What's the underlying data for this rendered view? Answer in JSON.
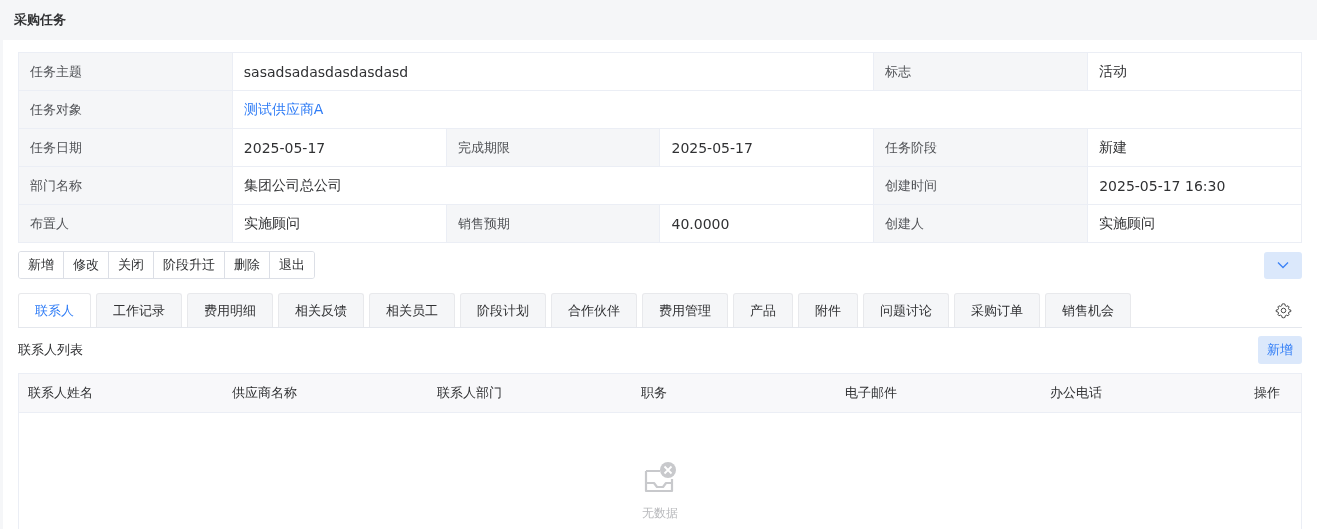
{
  "page_title": "采购任务",
  "details": [
    [
      {
        "label": "任务主题",
        "value": "sasadsadasdasdasdasd",
        "kind": "text"
      },
      {
        "label": "标志",
        "value": "活动",
        "kind": "text"
      }
    ],
    [
      {
        "label": "任务对象",
        "value": "测试供应商A",
        "kind": "link"
      }
    ],
    [
      {
        "label": "任务日期",
        "value": "2025-05-17",
        "kind": "text"
      },
      {
        "label": "完成期限",
        "value": "2025-05-17",
        "kind": "text"
      },
      {
        "label": "任务阶段",
        "value": "新建",
        "kind": "text"
      }
    ],
    [
      {
        "label": "部门名称",
        "value": "集团公司总公司",
        "kind": "text"
      },
      {
        "label": "创建时间",
        "value": "2025-05-17 16:30",
        "kind": "text"
      }
    ],
    [
      {
        "label": "布置人",
        "value": "实施顾问",
        "kind": "text"
      },
      {
        "label": "销售预期",
        "value": "40.0000",
        "kind": "text"
      },
      {
        "label": "创建人",
        "value": "实施顾问",
        "kind": "text"
      }
    ]
  ],
  "actions": [
    "新增",
    "修改",
    "关闭",
    "阶段升迁",
    "删除",
    "退出"
  ],
  "tabs": [
    {
      "label": "联系人",
      "selected": true
    },
    {
      "label": "工作记录",
      "selected": false
    },
    {
      "label": "费用明细",
      "selected": false
    },
    {
      "label": "相关反馈",
      "selected": false
    },
    {
      "label": "相关员工",
      "selected": false
    },
    {
      "label": "阶段计划",
      "selected": false
    },
    {
      "label": "合作伙伴",
      "selected": false
    },
    {
      "label": "费用管理",
      "selected": false
    },
    {
      "label": "产品",
      "selected": false
    },
    {
      "label": "附件",
      "selected": false
    },
    {
      "label": "问题讨论",
      "selected": false
    },
    {
      "label": "采购订单",
      "selected": false
    },
    {
      "label": "销售机会",
      "selected": false
    }
  ],
  "list_title": "联系人列表",
  "add_button": "新增",
  "table": {
    "columns": [
      "联系人姓名",
      "供应商名称",
      "联系人部门",
      "职务",
      "电子邮件",
      "办公电话",
      "操作"
    ],
    "empty_text": "无数据"
  }
}
